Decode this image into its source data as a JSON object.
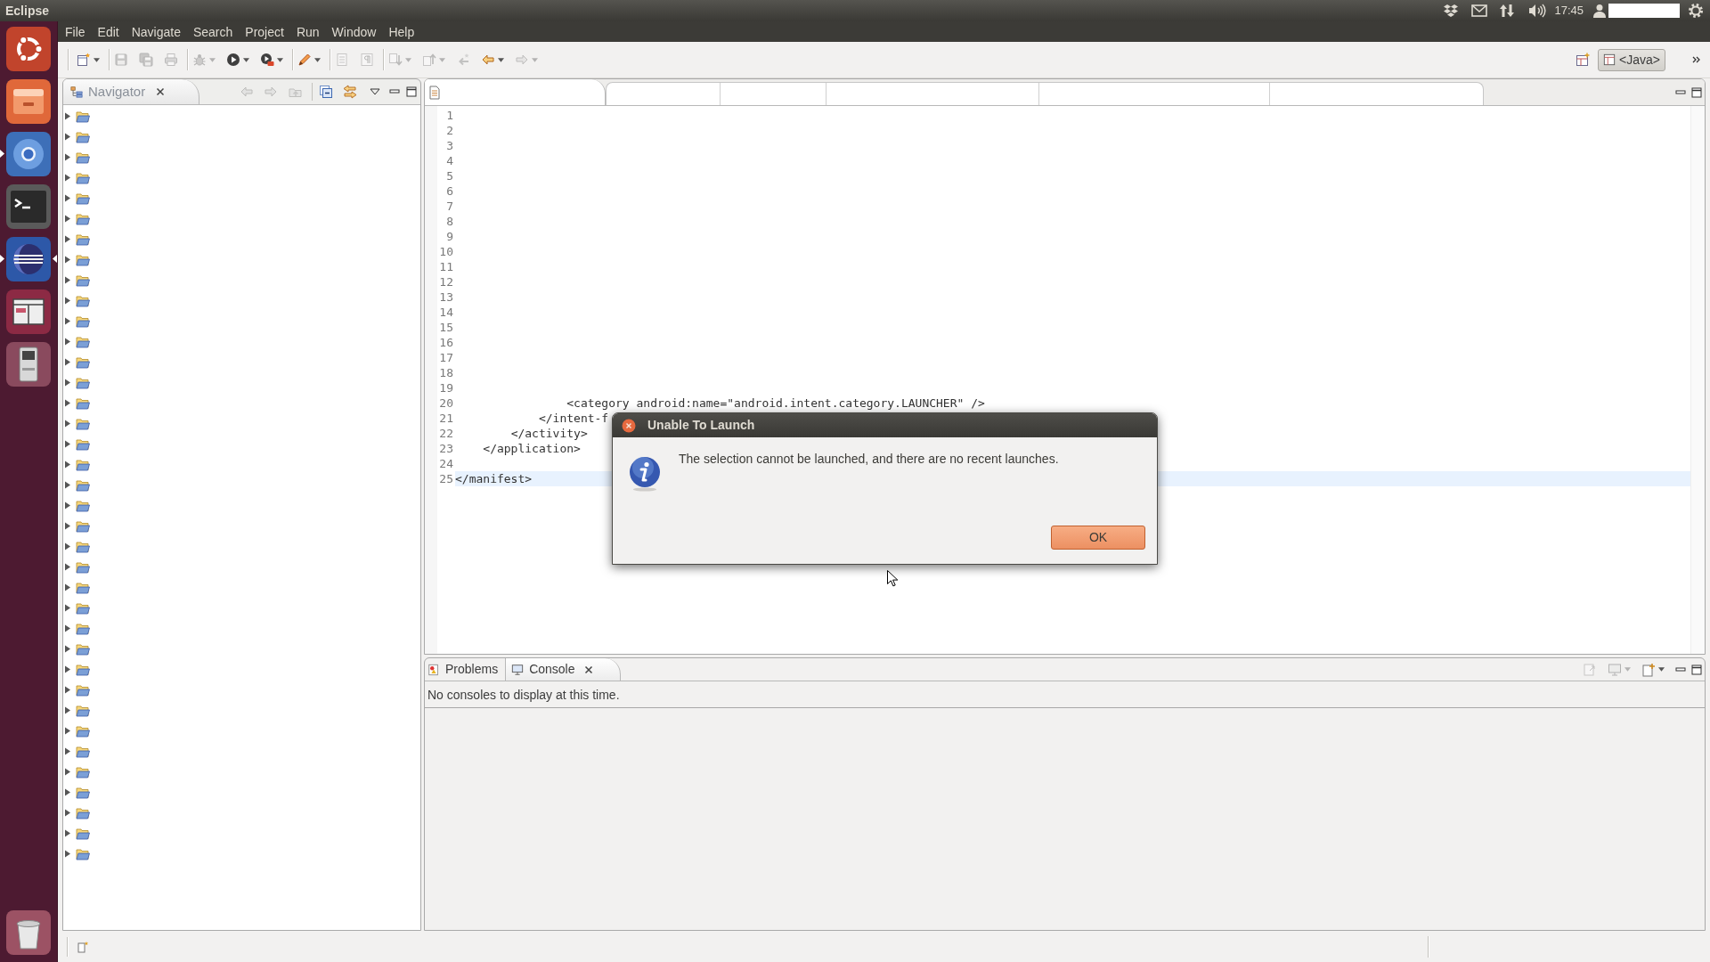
{
  "top_panel": {
    "title": "Eclipse",
    "clock": "17:45"
  },
  "launcher": {
    "items": [
      {
        "running": false,
        "active": false
      },
      {
        "running": false,
        "active": false
      },
      {
        "running": true,
        "active": false
      },
      {
        "running": false,
        "active": false
      },
      {
        "running": true,
        "active": true
      },
      {
        "running": false,
        "active": false
      },
      {
        "running": false,
        "active": false
      }
    ]
  },
  "menu": [
    "File",
    "Edit",
    "Navigate",
    "Search",
    "Project",
    "Run",
    "Window",
    "Help"
  ],
  "toolbar": {
    "groups": [
      [
        {
          "disabled": false,
          "dropdown": true
        }
      ],
      [
        {
          "disabled": true,
          "dropdown": false
        },
        {
          "disabled": true,
          "dropdown": false
        },
        {
          "disabled": true,
          "dropdown": false
        }
      ],
      [
        {
          "disabled": true,
          "dropdown": true
        },
        {
          "disabled": false,
          "dropdown": true
        },
        {
          "disabled": false,
          "dropdown": true
        }
      ],
      [
        {
          "disabled": false,
          "dropdown": true
        }
      ],
      [
        {
          "disabled": true,
          "dropdown": false
        },
        {
          "disabled": true,
          "dropdown": false
        }
      ],
      [
        {
          "disabled": true,
          "dropdown": true
        },
        {
          "disabled": true,
          "dropdown": true
        },
        {
          "disabled": true,
          "dropdown": false
        },
        {
          "disabled": false,
          "dropdown": true
        },
        {
          "disabled": true,
          "dropdown": true
        }
      ]
    ]
  },
  "perspectives": [
    {
      "label": "<Java>",
      "selected": true
    }
  ],
  "navigator": {
    "title": "Navigator",
    "toolbar": [
      {
        "disabled": true
      },
      {
        "disabled": true
      },
      {
        "disabled": true
      },
      {
        "disabled": false
      },
      {
        "disabled": false
      }
    ],
    "items": [
      {
        "expanded": false
      },
      {
        "expanded": false
      },
      {
        "expanded": false
      },
      {
        "expanded": false
      },
      {
        "expanded": false
      },
      {
        "expanded": false
      },
      {
        "expanded": false
      },
      {
        "expanded": false
      },
      {
        "expanded": false
      },
      {
        "expanded": false
      },
      {
        "expanded": false
      },
      {
        "expanded": false
      },
      {
        "expanded": false
      },
      {
        "expanded": false
      },
      {
        "expanded": false
      },
      {
        "expanded": false
      },
      {
        "expanded": false
      },
      {
        "expanded": false
      },
      {
        "expanded": false
      },
      {
        "expanded": false
      },
      {
        "expanded": false
      },
      {
        "expanded": false
      },
      {
        "expanded": false
      },
      {
        "expanded": false
      },
      {
        "expanded": false
      },
      {
        "expanded": false
      },
      {
        "expanded": false
      },
      {
        "expanded": false
      },
      {
        "expanded": false
      },
      {
        "expanded": false
      },
      {
        "expanded": false
      },
      {
        "expanded": false
      },
      {
        "expanded": false
      },
      {
        "expanded": false
      },
      {
        "expanded": false
      },
      {
        "expanded": false
      },
      {
        "expanded": false
      }
    ]
  },
  "editor": {
    "lines": [
      {
        "number": "1",
        "current": false
      },
      {
        "number": "2",
        "current": false
      },
      {
        "number": "3",
        "current": false
      },
      {
        "number": "4",
        "current": false
      },
      {
        "number": "5",
        "current": false
      },
      {
        "number": "6",
        "current": false
      },
      {
        "number": "7",
        "current": false
      },
      {
        "number": "8",
        "current": false
      },
      {
        "number": "9",
        "current": false
      },
      {
        "number": "10",
        "current": false
      },
      {
        "number": "11",
        "current": false
      },
      {
        "number": "12",
        "current": false
      },
      {
        "number": "13",
        "current": false
      },
      {
        "number": "14",
        "current": false
      },
      {
        "number": "15",
        "current": false
      },
      {
        "number": "16",
        "current": false
      },
      {
        "number": "17",
        "current": false
      },
      {
        "number": "18",
        "current": false
      },
      {
        "number": "19",
        "current": false
      },
      {
        "number": "20",
        "text": "                <category android:name=\"android.intent.category.LAUNCHER\" />",
        "current": false
      },
      {
        "number": "21",
        "text": "            </intent-f",
        "current": false
      },
      {
        "number": "22",
        "text": "        </activity>",
        "current": false
      },
      {
        "number": "23",
        "text": "    </application>",
        "current": false
      },
      {
        "number": "24",
        "current": false
      },
      {
        "number": "25",
        "text": "</manifest>",
        "current": true
      }
    ]
  },
  "bottom_panel": {
    "tabs": [
      {
        "label": "Problems",
        "selected": false
      },
      {
        "label": "Console",
        "selected": true
      }
    ],
    "toolbar": [
      {
        "disabled": true,
        "dropdown": false
      },
      {
        "disabled": true,
        "dropdown": true
      },
      {
        "disabled": false,
        "dropdown": true
      }
    ],
    "message": "No consoles to display at this time."
  },
  "dialog": {
    "title": "Unable To Launch",
    "message": "The selection cannot be launched, and there are no recent launches.",
    "buttons": [
      {
        "label": "OK",
        "focused": true
      }
    ]
  }
}
